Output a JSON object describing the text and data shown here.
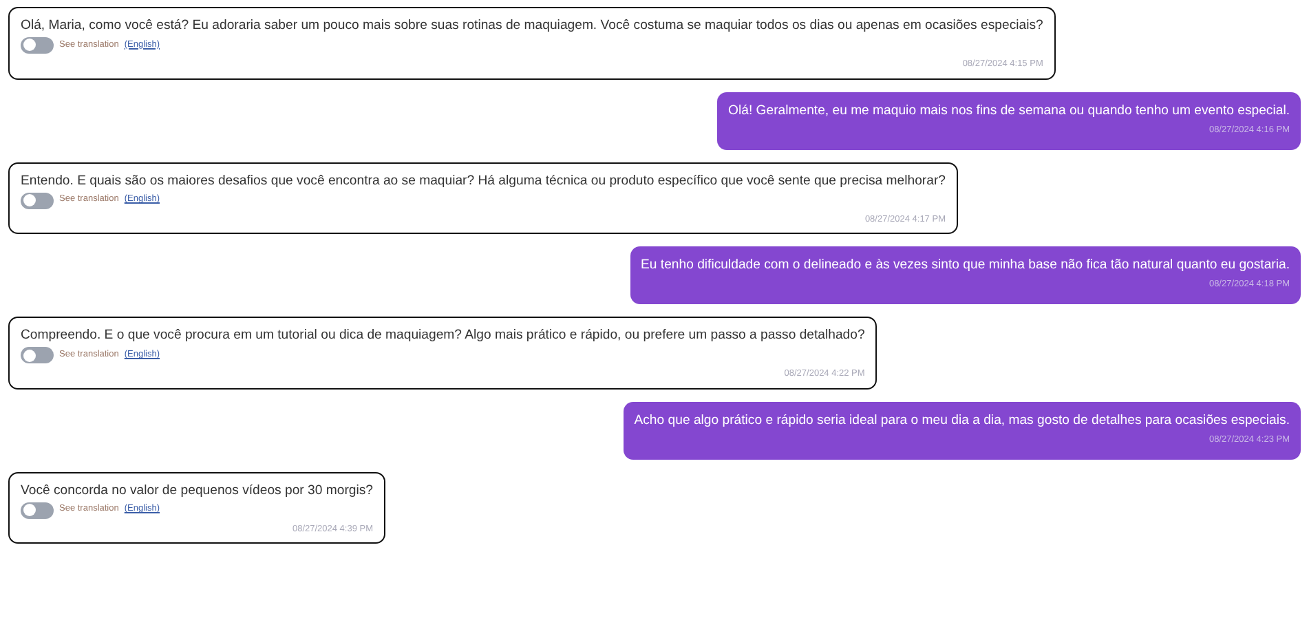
{
  "messages": [
    {
      "kind": "received",
      "text": "Olá, Maria, como você está? Eu adoraria saber um pouco mais sobre suas rotinas de maquiagem. Você costuma se maquiar todos os dias ou apenas em ocasiões especiais?",
      "translation": {
        "on": false,
        "label": "See translation",
        "language": "(English)"
      },
      "time": "08/27/2024 4:15 PM"
    },
    {
      "kind": "sent",
      "text": "Olá! Geralmente, eu me maquio mais nos fins de semana ou quando tenho um evento especial.",
      "time": "08/27/2024 4:16 PM"
    },
    {
      "kind": "received",
      "text": "Entendo. E quais são os maiores desafios que você encontra ao se maquiar? Há alguma técnica ou produto específico que você sente que precisa melhorar?",
      "translation": {
        "on": false,
        "label": "See translation",
        "language": "(English)"
      },
      "time": "08/27/2024 4:17 PM"
    },
    {
      "kind": "sent",
      "text": "Eu tenho dificuldade com o delineado e às vezes sinto que minha base não fica tão natural quanto eu gostaria.",
      "time": "08/27/2024 4:18 PM"
    },
    {
      "kind": "received",
      "text": "Compreendo. E o que você procura em um tutorial ou dica de maquiagem? Algo mais prático e rápido, ou prefere um passo a passo detalhado?",
      "translation": {
        "on": false,
        "label": "See translation",
        "language": "(English)"
      },
      "time": "08/27/2024 4:22 PM"
    },
    {
      "kind": "sent",
      "text": "Acho que algo prático e rápido seria ideal para o meu dia a dia, mas gosto de detalhes para ocasiões especiais.",
      "time": "08/27/2024 4:23 PM"
    },
    {
      "kind": "received",
      "text": "Você concorda no valor de pequenos vídeos por 30 morgis?",
      "translation": {
        "on": false,
        "label": "See translation",
        "language": "(English)"
      },
      "time": "08/27/2024 4:39 PM"
    }
  ]
}
